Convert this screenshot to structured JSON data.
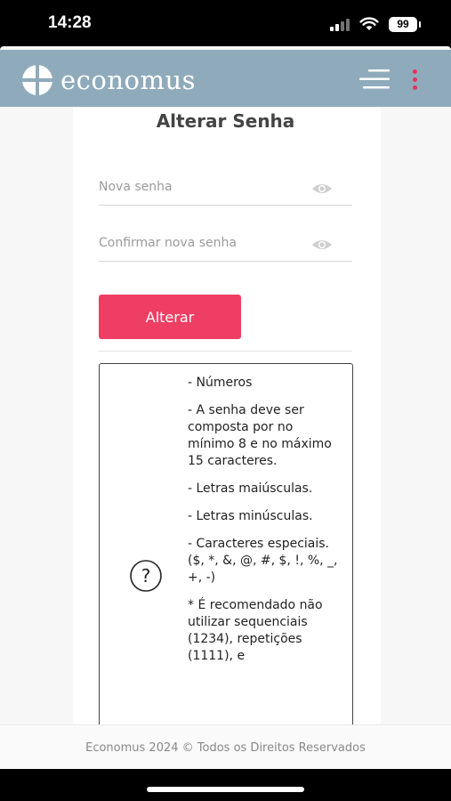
{
  "status": {
    "time": "14:28",
    "battery": "99"
  },
  "header": {
    "logo_text": "economus"
  },
  "form": {
    "title": "Alterar Senha",
    "new_password_placeholder": "Nova senha",
    "confirm_password_placeholder": "Confirmar nova senha",
    "submit_label": "Alterar"
  },
  "rules": [
    "- Números",
    "- A senha deve ser composta por no mínimo 8 e no máximo 15 caracteres.",
    "- Letras maiúsculas.",
    "- Letras minúsculas.",
    "- Caracteres especiais. ($, *, &, @, #, $, !, %, _, +, -)",
    "* É recomendado não utilizar sequenciais (1234), repetições (1111), e"
  ],
  "footer": {
    "text": "Economus 2024 © Todos os Direitos Reservados"
  },
  "colors": {
    "header_bg": "#8fabbb",
    "accent": "#ee3e63"
  }
}
